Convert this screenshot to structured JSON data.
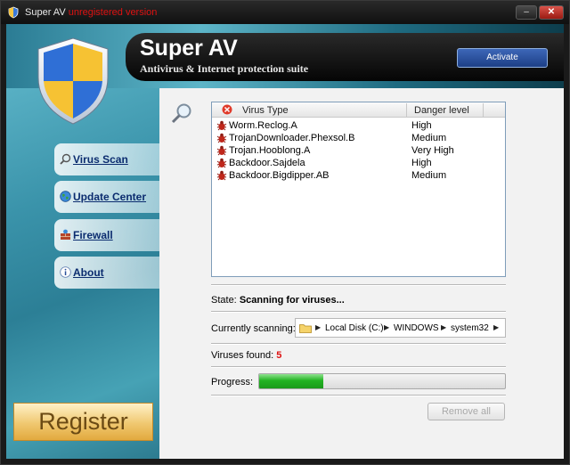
{
  "window": {
    "title": "Super AV",
    "title_suffix": "unregistered version",
    "minimize_label": "‒",
    "close_label": "✕"
  },
  "header": {
    "app_title": "Super AV",
    "subtitle": "Antivirus & Internet protection suite",
    "activate_label": "Activate"
  },
  "sidebar": {
    "items": [
      {
        "label": "Virus Scan",
        "icon": "magnifier-icon"
      },
      {
        "label": "Update Center",
        "icon": "globe-icon"
      },
      {
        "label": "Firewall",
        "icon": "firewall-icon"
      },
      {
        "label": "About",
        "icon": "info-icon"
      }
    ],
    "register_label": "Register"
  },
  "table": {
    "columns": [
      "Virus Type",
      "Danger level"
    ],
    "rows": [
      {
        "name": "Worm.Reclog.A",
        "level": "High"
      },
      {
        "name": "TrojanDownloader.Phexsol.B",
        "level": "Medium"
      },
      {
        "name": "Trojan.Hooblong.A",
        "level": "Very High"
      },
      {
        "name": "Backdoor.Sajdela",
        "level": "High"
      },
      {
        "name": "Backdoor.Bigdipper.AB",
        "level": "Medium"
      }
    ]
  },
  "status": {
    "state_label": "State:",
    "state_value": "Scanning for viruses...",
    "scanning_label": "Currently scanning:",
    "path": [
      "Local Disk (C:)",
      "WINDOWS",
      "system32"
    ],
    "found_label": "Viruses found:",
    "found_count": "5",
    "progress_label": "Progress:",
    "progress_fraction": 0.26,
    "remove_label": "Remove all"
  },
  "colors": {
    "accent": "#2c7f96",
    "progress_green": "#22b322",
    "alert_red": "#dd1111"
  }
}
